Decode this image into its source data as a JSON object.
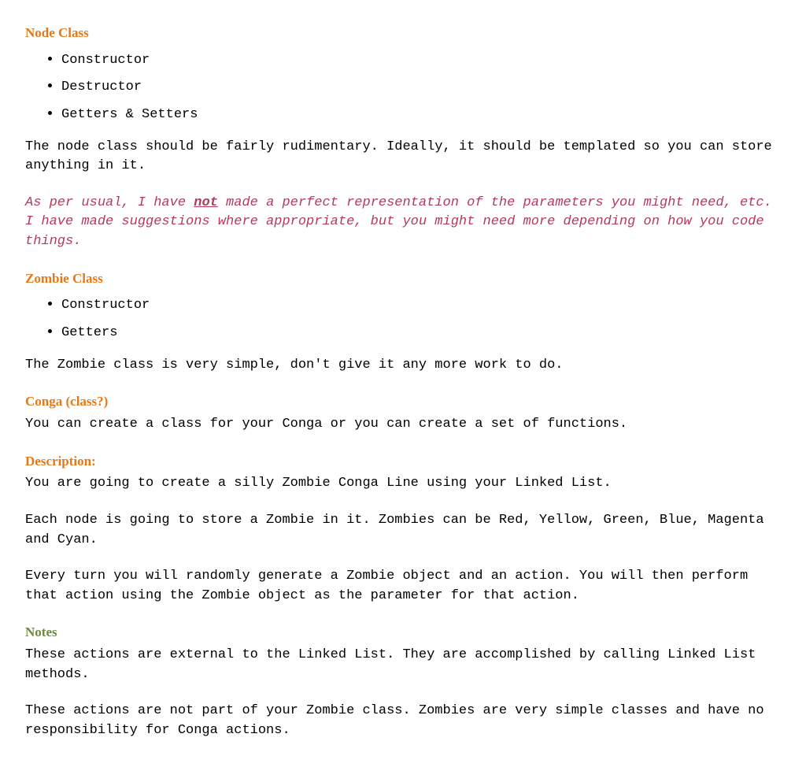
{
  "sections": {
    "nodeClass": {
      "heading": "Node Class",
      "bullets": [
        "Constructor",
        "Destructor",
        "Getters & Setters"
      ],
      "body": "The node class should be fairly rudimentary.  Ideally, it should be templated so you can store anything in it."
    },
    "note": {
      "prefix": "As per usual, I have ",
      "emph": "not",
      "suffix": " made a perfect representation of the parameters you might need, etc.  I have made suggestions where appropriate, but you might need more depending on how you code things."
    },
    "zombieClass": {
      "heading": "Zombie Class",
      "bullets": [
        "Constructor",
        "Getters"
      ],
      "body": "The Zombie class is very simple, don't give it any more work to do."
    },
    "conga": {
      "heading": "Conga (class?)",
      "body": "You can create a class for your Conga or you can create a set of functions."
    },
    "description": {
      "heading": "Description:",
      "para1": "You are going to create a silly Zombie Conga Line using your Linked List.",
      "para2": "Each node is going to store a Zombie in it.  Zombies can be Red, Yellow, Green, Blue, Magenta and Cyan.",
      "para3": "Every turn you will randomly generate a Zombie object and an action.  You will then perform that action using the Zombie object as the parameter for that action."
    },
    "notes": {
      "heading": "Notes",
      "para1": "These actions are external to the Linked List.  They are accomplished by calling Linked List methods.",
      "para2": "These actions are not part of your Zombie class.  Zombies are very simple classes and have no responsibility for Conga actions."
    }
  }
}
